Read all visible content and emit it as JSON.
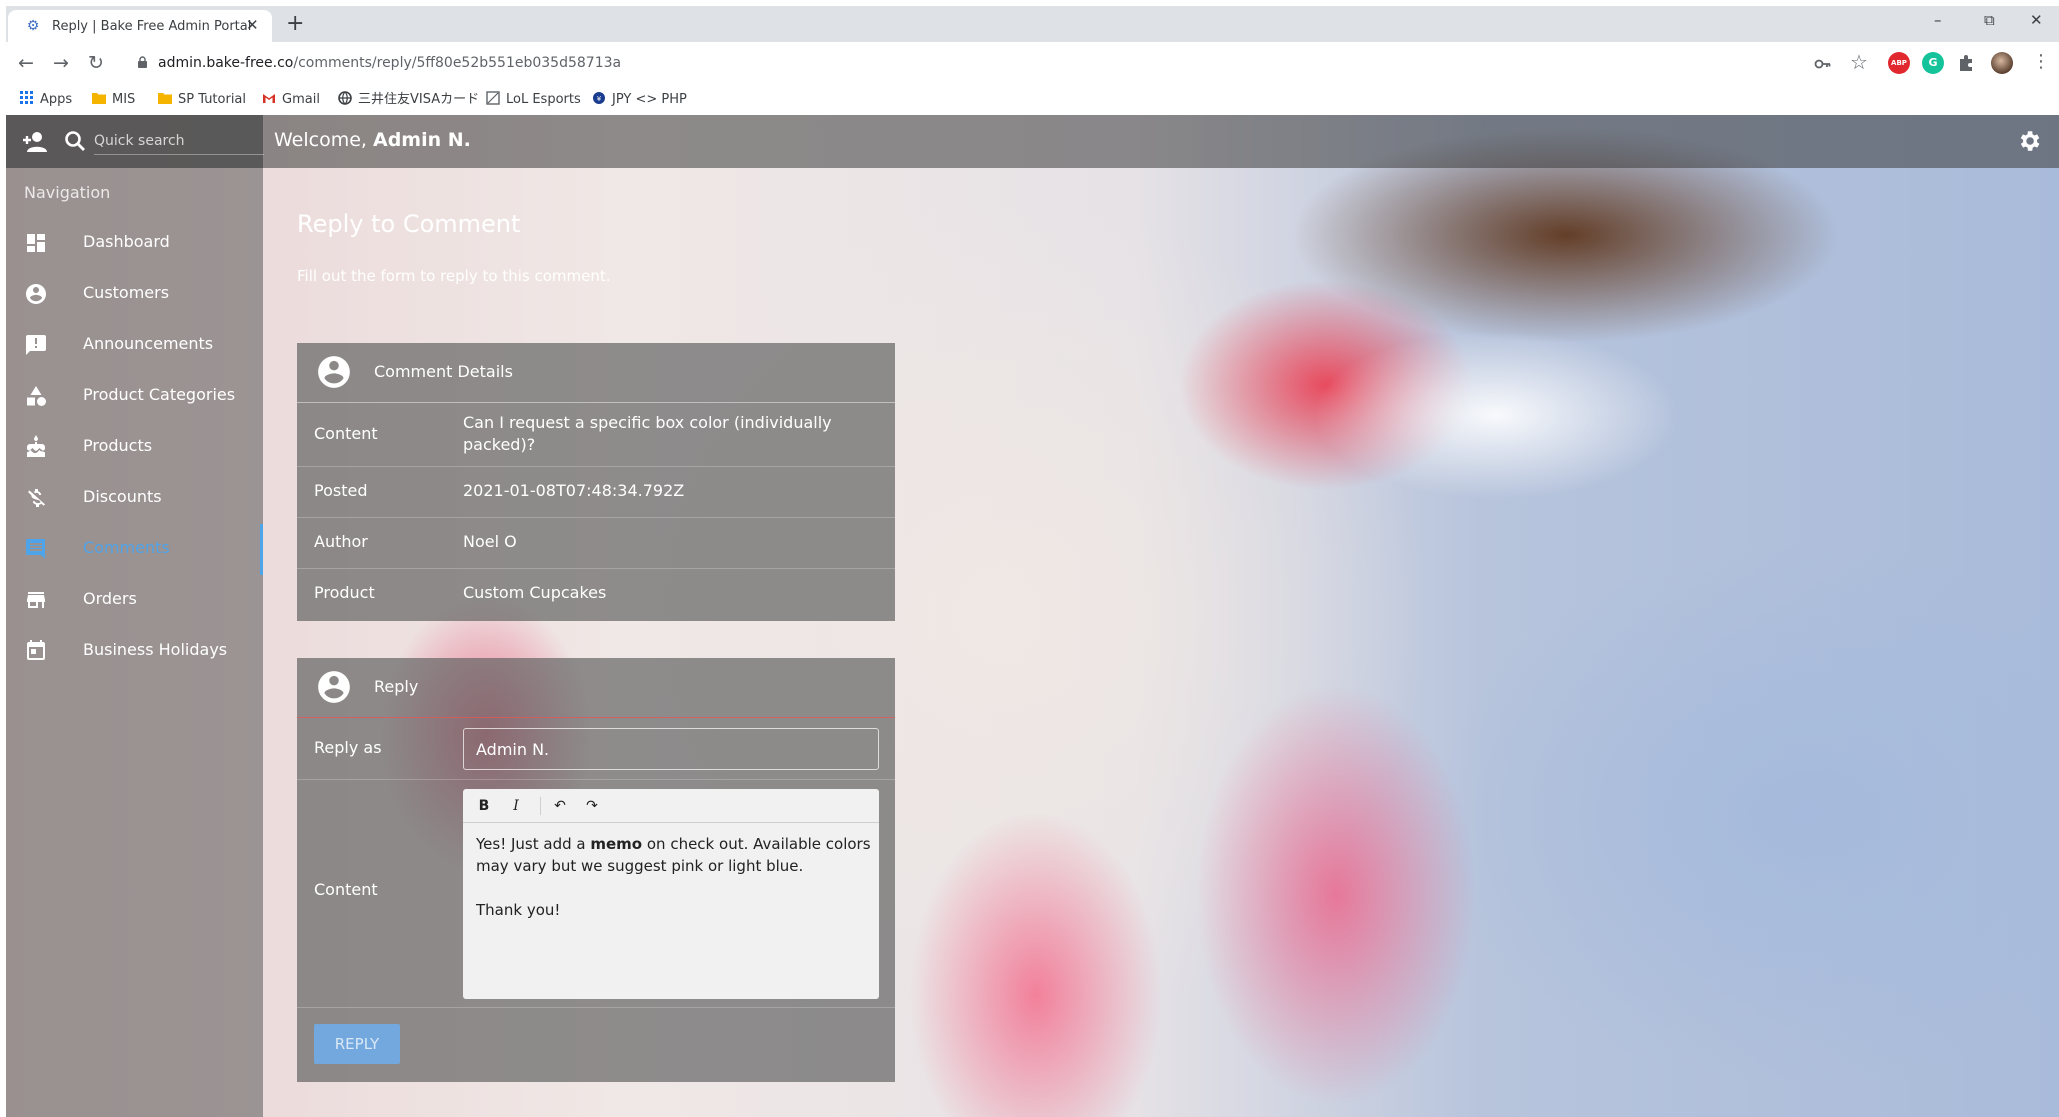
{
  "browser": {
    "tab_title": "Reply | Bake Free Admin Portal",
    "tab_close": "✕",
    "new_tab": "+",
    "url_host": "admin.bake-free.co",
    "url_path": "/comments/reply/5ff80e52b551eb035d58713a",
    "window_controls": {
      "minimize": "–",
      "restore": "⧉",
      "close": "✕"
    },
    "bookmarks": [
      {
        "label": "Apps",
        "icon": "apps-grid-icon"
      },
      {
        "label": "MIS",
        "icon": "folder-icon"
      },
      {
        "label": "SP Tutorial",
        "icon": "folder-icon"
      },
      {
        "label": "Gmail",
        "icon": "gmail-icon"
      },
      {
        "label": "三井住友VISAカード",
        "icon": "globe-icon"
      },
      {
        "label": "LoL Esports",
        "icon": "image-icon"
      },
      {
        "label": "JPY <> PHP",
        "icon": "currency-icon"
      }
    ],
    "extensions": [
      {
        "name": "adblock-icon",
        "text": "ABP",
        "color": "#e0282e"
      },
      {
        "name": "grammarly-icon",
        "text": "G",
        "color": "#15c39a"
      }
    ]
  },
  "app": {
    "search_placeholder": "Quick search",
    "welcome_prefix": "Welcome, ",
    "welcome_name": "Admin N.",
    "nav_heading": "Navigation",
    "nav_items": [
      {
        "label": "Dashboard",
        "icon": "dashboard-icon"
      },
      {
        "label": "Customers",
        "icon": "account-circle-icon"
      },
      {
        "label": "Announcements",
        "icon": "announcement-icon"
      },
      {
        "label": "Product Categories",
        "icon": "category-icon"
      },
      {
        "label": "Products",
        "icon": "cake-icon"
      },
      {
        "label": "Discounts",
        "icon": "money-off-icon"
      },
      {
        "label": "Comments",
        "icon": "comment-icon",
        "active": true
      },
      {
        "label": "Orders",
        "icon": "store-icon"
      },
      {
        "label": "Business Holidays",
        "icon": "calendar-icon"
      }
    ],
    "accent_color": "#4fa3e8"
  },
  "page": {
    "title": "Reply to Comment",
    "subtitle": "Fill out the form to reply to this comment."
  },
  "comment_details": {
    "title": "Comment Details",
    "rows": [
      {
        "key": "Content",
        "value": "Can I request a specific box color (individually packed)?"
      },
      {
        "key": "Posted",
        "value": "2021-01-08T07:48:34.792Z"
      },
      {
        "key": "Author",
        "value": "Noel O"
      },
      {
        "key": "Product",
        "value": "Custom Cupcakes"
      }
    ]
  },
  "reply": {
    "title": "Reply",
    "reply_as_label": "Reply as",
    "reply_as_value": "Admin N.",
    "content_label": "Content",
    "toolbar": {
      "bold": "B",
      "italic": "I",
      "undo": "↶",
      "redo": "↷"
    },
    "body": {
      "line1_before": "Yes! Just add a ",
      "line1_bold": "memo",
      "line1_after": " on check out. Available colors may vary but we suggest pink or light blue.",
      "line2": "Thank you!"
    },
    "submit_label": "REPLY",
    "submit_color": "#73a8de"
  }
}
